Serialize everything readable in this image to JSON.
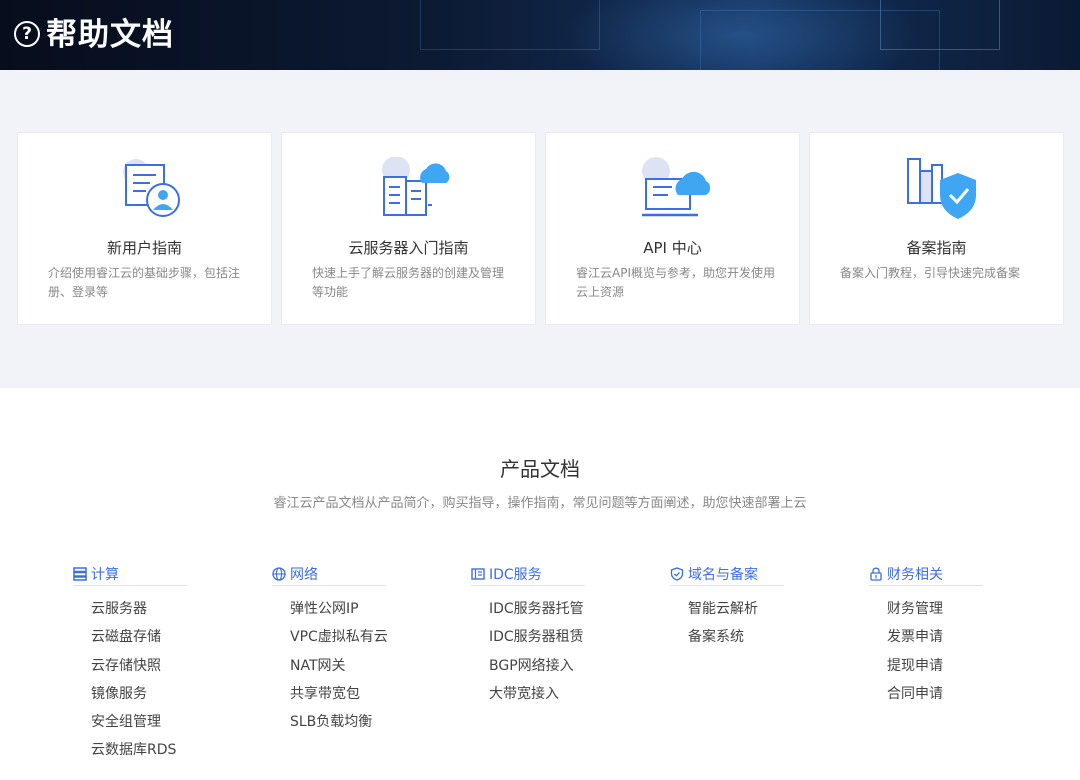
{
  "header": {
    "title": "帮助文档",
    "icon": "question-circle-icon"
  },
  "guides": [
    {
      "title": "新用户指南",
      "desc": "介绍使用睿江云的基础步骤，包括注册、登录等",
      "icon": "new-user-guide-icon"
    },
    {
      "title": "云服务器入门指南",
      "desc": "快速上手了解云服务器的创建及管理等功能",
      "icon": "cloud-server-guide-icon"
    },
    {
      "title": "API 中心",
      "desc": "睿江云API概览与参考，助您开发使用云上资源",
      "icon": "api-center-icon"
    },
    {
      "title": "备案指南",
      "desc": "备案入门教程，引导快速完成备案",
      "icon": "filing-guide-icon"
    }
  ],
  "docs": {
    "title": "产品文档",
    "subtitle": "睿江云产品文档从产品简介，购买指导，操作指南，常见问题等方面阐述，助您快速部署上云",
    "categories": [
      {
        "name": "计算",
        "icon": "server-icon",
        "items": [
          "云服务器",
          "云磁盘存储",
          "云存储快照",
          "镜像服务",
          "安全组管理",
          "云数据库RDS"
        ]
      },
      {
        "name": "网络",
        "icon": "globe-icon",
        "items": [
          "弹性公网IP",
          "VPC虚拟私有云",
          "NAT网关",
          "共享带宽包",
          "SLB负载均衡"
        ]
      },
      {
        "name": "IDC服务",
        "icon": "idc-icon",
        "items": [
          "IDC服务器托管",
          "IDC服务器租赁",
          "BGP网络接入",
          "大带宽接入"
        ]
      },
      {
        "name": "域名与备案",
        "icon": "shield-check-icon",
        "items": [
          "智能云解析",
          "备案系统"
        ]
      },
      {
        "name": "财务相关",
        "icon": "lock-money-icon",
        "items": [
          "财务管理",
          "发票申请",
          "提现申请",
          "合同申请"
        ]
      }
    ]
  },
  "colors": {
    "accent": "#3d6ee2",
    "banner": "#0c1a33",
    "guide_bg": "#f2f3f8"
  }
}
